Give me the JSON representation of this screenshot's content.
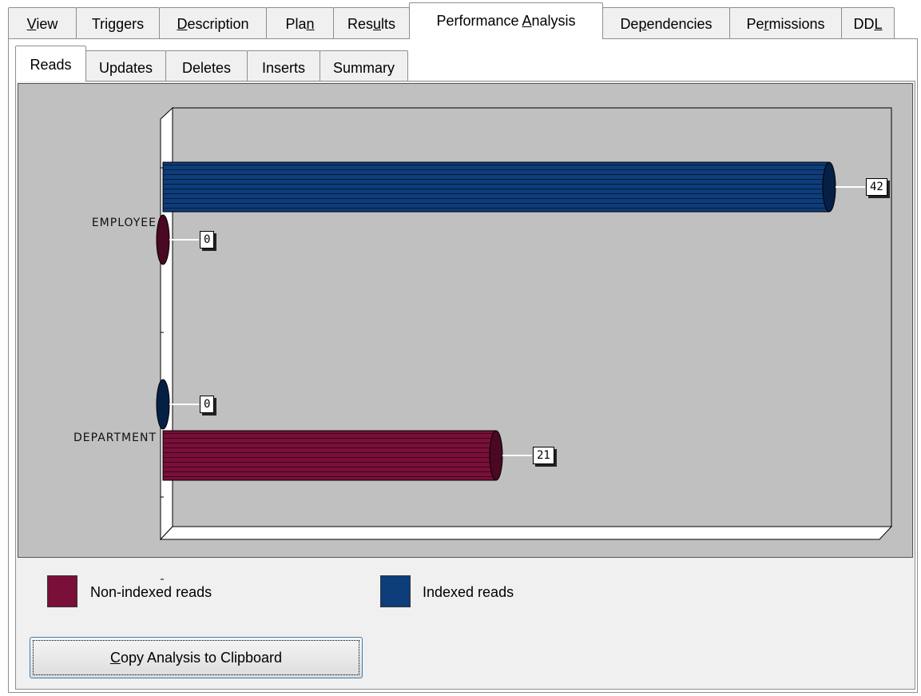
{
  "tabs_top": [
    {
      "label": "View",
      "u": "V"
    },
    {
      "label": "Triggers",
      "u": ""
    },
    {
      "label": "Description",
      "u": "D"
    },
    {
      "label": "Plan",
      "u": "n"
    },
    {
      "label": "Results",
      "u": "u"
    },
    {
      "label": "Performance Analysis",
      "u": "A",
      "active": true
    },
    {
      "label": "Dependencies",
      "u": "p"
    },
    {
      "label": "Permissions",
      "u": "r"
    },
    {
      "label": "DDL",
      "u": "L"
    }
  ],
  "tabs_sub": [
    {
      "label": "Reads",
      "active": true
    },
    {
      "label": "Updates"
    },
    {
      "label": "Deletes"
    },
    {
      "label": "Inserts"
    },
    {
      "label": "Summary"
    }
  ],
  "chart_data": {
    "type": "bar",
    "orientation": "horizontal",
    "categories": [
      "EMPLOYEE",
      "DEPARTMENT"
    ],
    "series": [
      {
        "name": "Non-indexed reads",
        "color": "#7a0f3a",
        "values": [
          0,
          21
        ]
      },
      {
        "name": "Indexed reads",
        "color": "#0d3d7a",
        "values": [
          42,
          0
        ]
      }
    ],
    "xlim": [
      0,
      42
    ],
    "legend": "bottom"
  },
  "legend": {
    "non_indexed": "Non-indexed reads",
    "indexed": "Indexed reads"
  },
  "copy_button": "Copy Analysis to Clipboard"
}
